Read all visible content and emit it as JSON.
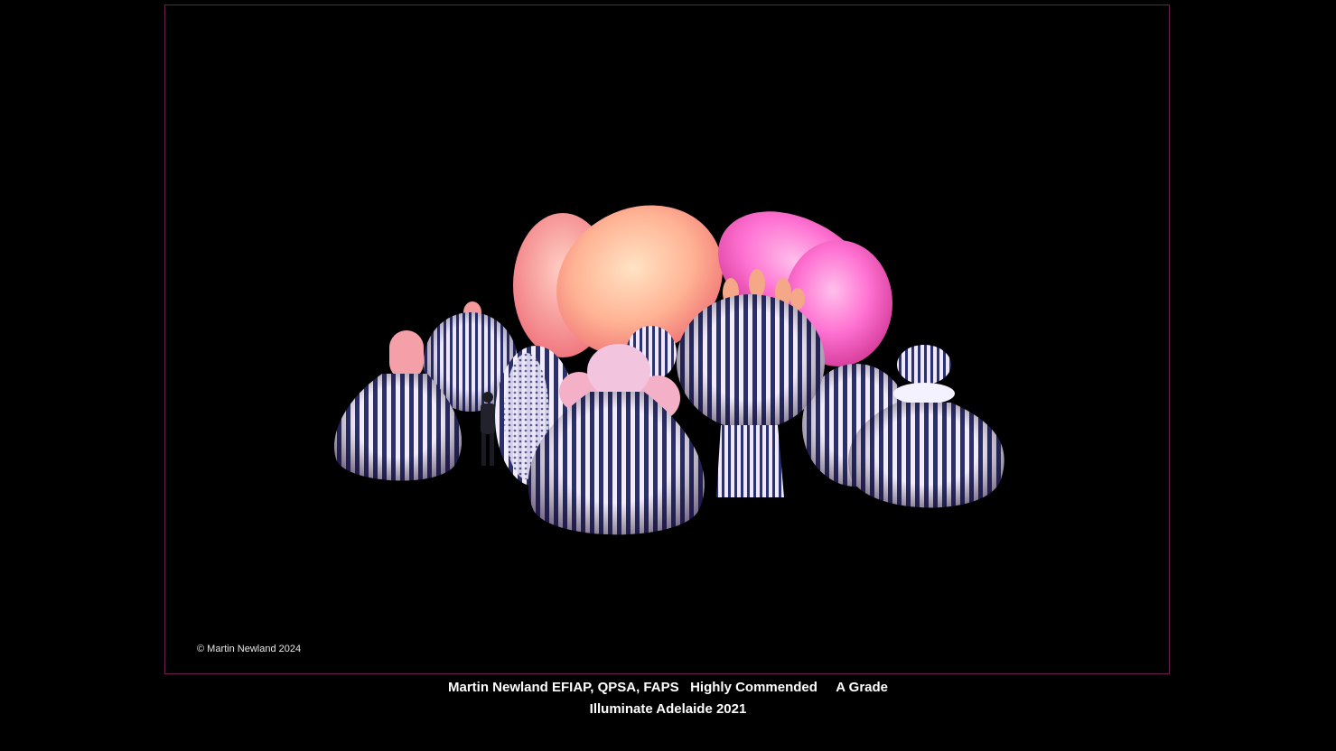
{
  "photo": {
    "copyright": "© Martin Newland 2024",
    "subject": "illuminated inflatable sculptures at night"
  },
  "caption": {
    "line1": "Martin Newland EFIAP, QPSA, FAPS   Highly Commended     A Grade",
    "line2": "Illuminate Adelaide 2021"
  },
  "colors": {
    "background": "#000000",
    "frame_border": "#6b1f4f",
    "caption_text": "#ffffff"
  }
}
